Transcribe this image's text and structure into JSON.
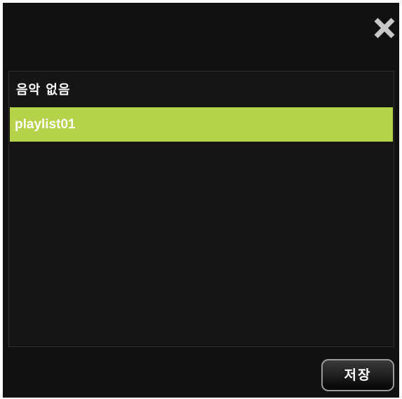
{
  "dialog": {
    "close_icon": "close-icon",
    "header": "음악 없음",
    "playlists": [
      {
        "label": "playlist01",
        "selected": true
      }
    ],
    "save_label": "저장"
  },
  "colors": {
    "background": "#111111",
    "selection": "#b5d24a",
    "close_icon": "#c8c8c8"
  }
}
